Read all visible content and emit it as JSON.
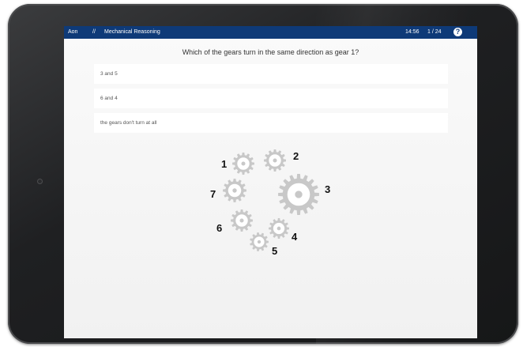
{
  "header": {
    "brand": "Aon",
    "separator": "//",
    "section": "Mechanical Reasoning",
    "timer": "14:56",
    "progress": "1 / 24",
    "help_glyph": "?"
  },
  "question": "Which of the gears turn in the same direction as gear 1?",
  "options": [
    {
      "label": "3 and 5"
    },
    {
      "label": "6 and 4"
    },
    {
      "label": "the gears don't turn at all"
    }
  ],
  "diagram": {
    "gear_color": "#c8c8c8",
    "labels": [
      "1",
      "2",
      "3",
      "4",
      "5",
      "6",
      "7"
    ]
  },
  "colors": {
    "header_bg": "#0e3a78",
    "screen_bg": "#f4f4f4",
    "option_bg": "#ffffff"
  }
}
